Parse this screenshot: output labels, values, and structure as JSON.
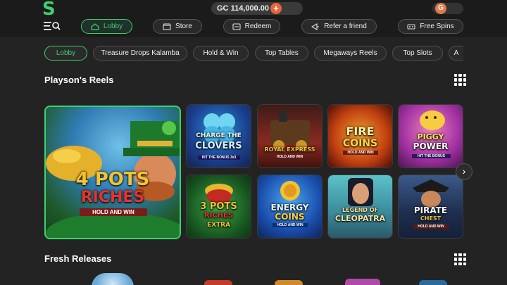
{
  "header": {
    "logo": "S",
    "currency": "GC",
    "balance": "114,000.00",
    "add_symbol": "+",
    "avatar_initial": "G"
  },
  "nav": {
    "lobby": "Lobby",
    "store": "Store",
    "redeem": "Redeem",
    "refer": "Refer a friend",
    "free_spins": "Free Spins"
  },
  "categories": [
    "Lobby",
    "Treasure Drops Kalamba",
    "Hold & Win",
    "Top Tables",
    "Megaways Reels",
    "Top Slots",
    "A"
  ],
  "sections": {
    "reels_title": "Playson's Reels",
    "fresh_title": "Fresh Releases"
  },
  "games": {
    "featured": {
      "line1": "4 POTS",
      "line2": "RICHES",
      "line3": "HOLD AND WIN"
    },
    "charge": {
      "line1": "CHARGE THE",
      "line2": "CLOVERS",
      "line3": "HIT THE BONUS 3x3"
    },
    "royal": {
      "line1": "ROYAL EXPRESS",
      "line2": "HOLD AND WIN"
    },
    "fire": {
      "line1": "FIRE",
      "line2": "COINS",
      "line3": "HOLD AND WIN"
    },
    "piggy": {
      "line1": "PIGGY",
      "line2": "POWER",
      "line3": "HIT THE BONUS"
    },
    "pots3": {
      "line1": "3 POTS",
      "line2": "RICHES",
      "line3": "EXTRA"
    },
    "energy": {
      "line1": "ENERGY",
      "line2": "COINS",
      "line3": "HOLD AND WIN"
    },
    "cleo": {
      "line1": "LEGEND OF",
      "line2": "CLEOPATRA"
    },
    "pirate": {
      "line1": "PIRATE",
      "line2": "CHEST",
      "line3": "HOLD AND WIN"
    }
  },
  "colors": {
    "accent": "#3fd06e",
    "background": "#232323",
    "topbar": "#1b1b1b"
  }
}
